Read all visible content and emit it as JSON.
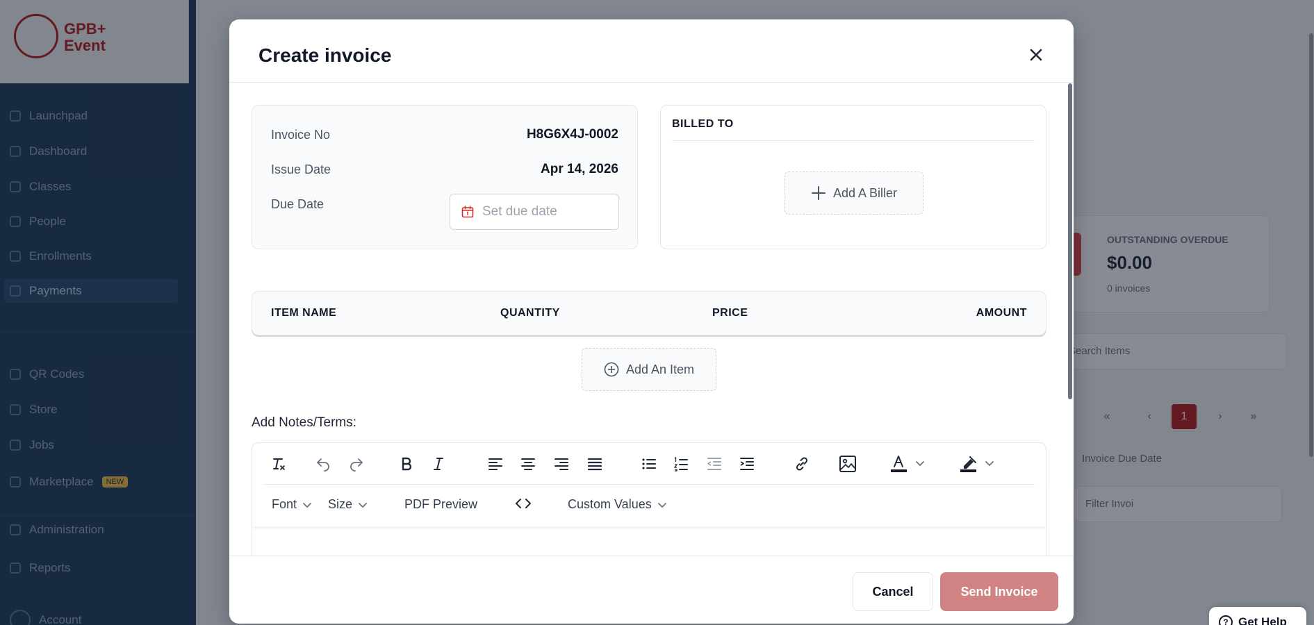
{
  "background": {
    "logo_text": "GPB+\nEvent",
    "nav_items": [
      {
        "label": "Launchpad"
      },
      {
        "label": "Dashboard"
      },
      {
        "label": "Classes"
      },
      {
        "label": "People"
      },
      {
        "label": "Enrollments"
      },
      {
        "label": "Payments"
      },
      {
        "label": "QR Codes"
      },
      {
        "label": "Store"
      },
      {
        "label": "Jobs"
      },
      {
        "label": "Marketplace"
      },
      {
        "label": "Administration"
      },
      {
        "label": "Reports"
      }
    ],
    "marketplace_badge": "NEW",
    "user_name": "Account",
    "stat_title": "OUTSTANDING OVERDUE",
    "stat_value": "$0.00",
    "stat_sub": "0 invoices",
    "search_placeholder": "Search Items",
    "sort_label": "Invoice Due Date",
    "filter_label": "Filter Invoi",
    "current_page": "1"
  },
  "modal": {
    "title": "Create invoice",
    "invoice_no_label": "Invoice No",
    "invoice_no_value": "H8G6X4J-0002",
    "issue_date_label": "Issue Date",
    "issue_date_value": "Apr 14, 2026",
    "due_date_label": "Due Date",
    "due_date_placeholder": "Set due date",
    "billed_to_title": "BILLED TO",
    "add_biller_label": "Add A Biller",
    "table_headers": {
      "item_name": "ITEM NAME",
      "quantity": "QUANTITY",
      "price": "PRICE",
      "amount": "AMOUNT"
    },
    "add_item_label": "Add An Item",
    "notes_label": "Add Notes/Terms:",
    "editor_toolbar": {
      "font_label": "Font",
      "size_label": "Size",
      "pdf_preview_label": "PDF Preview",
      "custom_values_label": "Custom Values"
    },
    "cancel_label": "Cancel",
    "send_label": "Send Invoice"
  },
  "help_label": "Get Help",
  "colors": {
    "brand_red": "#b91c1c",
    "send_button": "#d18384",
    "sidebar": "#1f3b5c"
  }
}
